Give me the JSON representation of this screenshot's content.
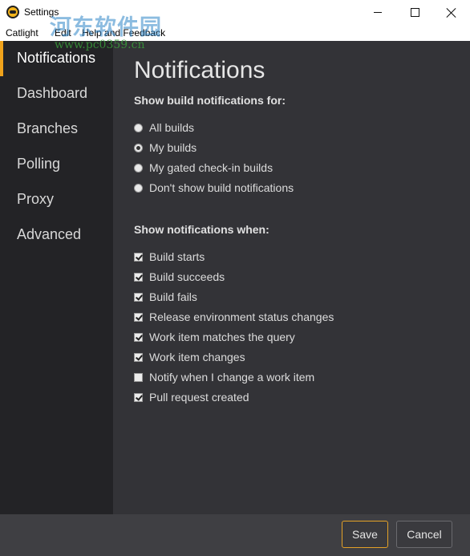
{
  "window": {
    "title": "Settings"
  },
  "menu": {
    "items": [
      "Catlight",
      "Edit",
      "Help and Feedback"
    ]
  },
  "watermark": {
    "text": "河东软件园",
    "url": "www.pc0359.cn"
  },
  "sidebar": {
    "items": [
      {
        "label": "Notifications",
        "active": true
      },
      {
        "label": "Dashboard"
      },
      {
        "label": "Branches"
      },
      {
        "label": "Polling"
      },
      {
        "label": "Proxy"
      },
      {
        "label": "Advanced"
      }
    ]
  },
  "main": {
    "title": "Notifications",
    "build_section": {
      "label": "Show build notifications for:",
      "options": [
        {
          "label": "All builds",
          "selected": false
        },
        {
          "label": "My builds",
          "selected": true
        },
        {
          "label": "My gated check-in builds",
          "selected": false
        },
        {
          "label": "Don't show build notifications",
          "selected": false
        }
      ]
    },
    "when_section": {
      "label": "Show notifications when:",
      "options": [
        {
          "label": "Build starts",
          "checked": true
        },
        {
          "label": "Build succeeds",
          "checked": true
        },
        {
          "label": "Build fails",
          "checked": true
        },
        {
          "label": "Release environment status changes",
          "checked": true
        },
        {
          "label": "Work item matches the query",
          "checked": true
        },
        {
          "label": "Work item changes",
          "checked": true
        },
        {
          "label": "Notify when I change a work item",
          "checked": false
        },
        {
          "label": "Pull request created",
          "checked": true
        }
      ]
    }
  },
  "footer": {
    "save_label": "Save",
    "cancel_label": "Cancel"
  },
  "colors": {
    "accent": "#f0a31b",
    "sidebar_bg": "#232326",
    "main_bg": "#333337"
  }
}
